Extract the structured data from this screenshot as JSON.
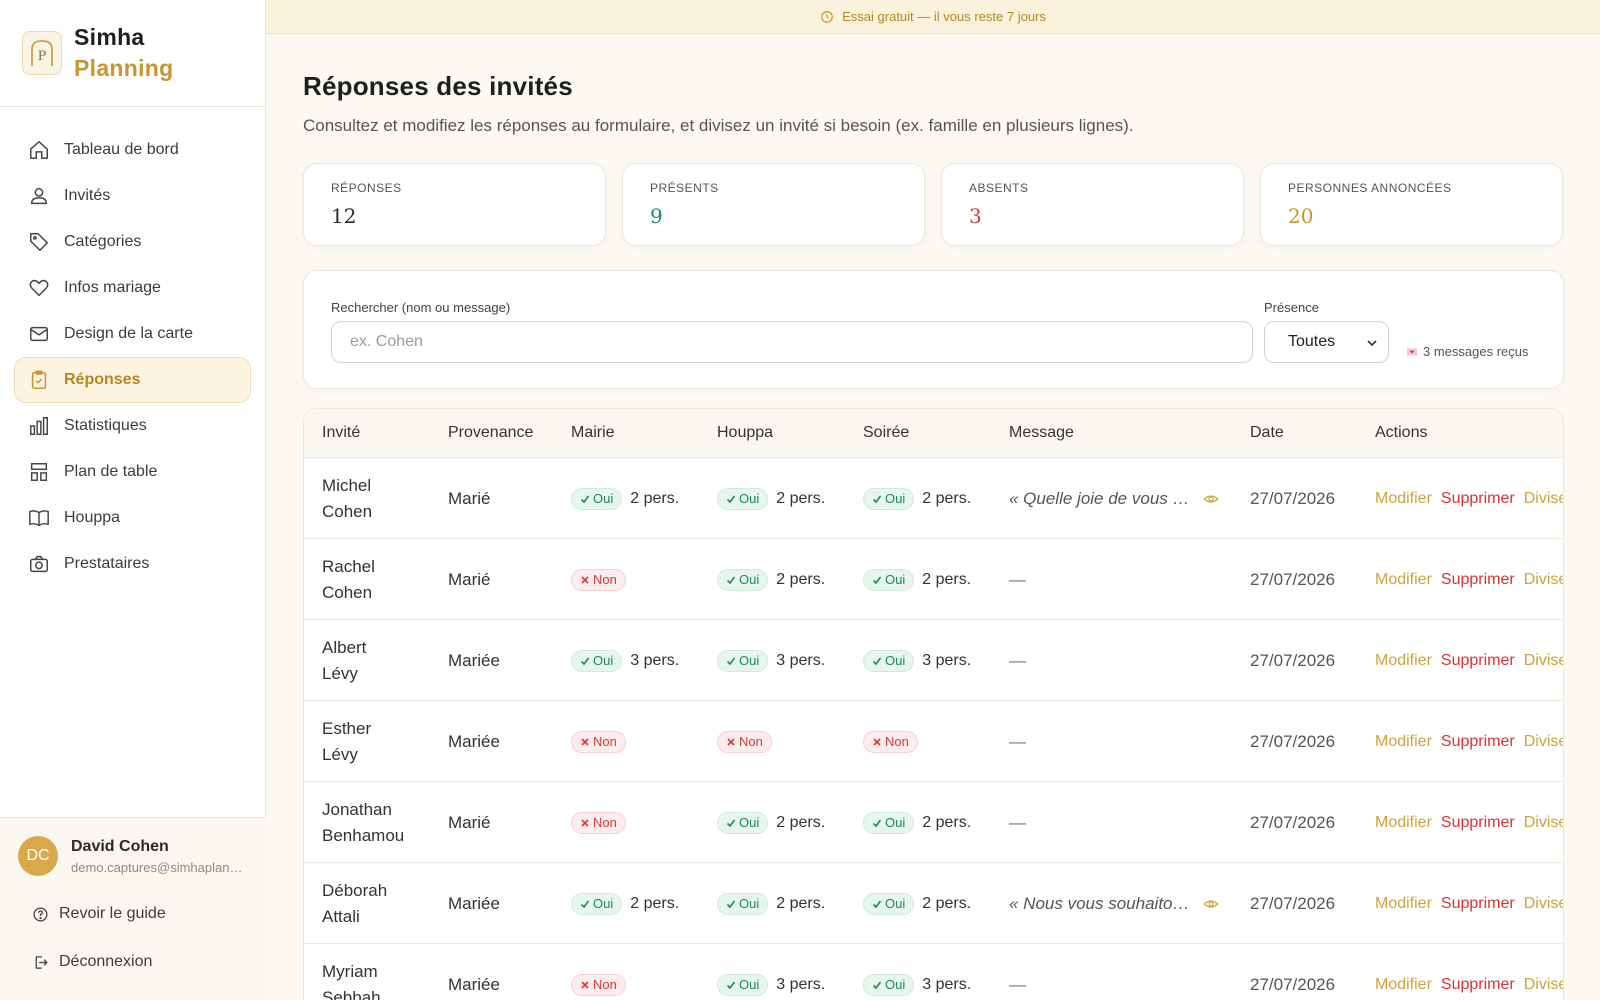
{
  "brand": {
    "line1": "Simha",
    "line2": "Planning"
  },
  "nav": [
    {
      "label": "Tableau de bord",
      "icon": "home-icon"
    },
    {
      "label": "Invités",
      "icon": "users-icon"
    },
    {
      "label": "Catégories",
      "icon": "tag-icon"
    },
    {
      "label": "Infos mariage",
      "icon": "heart-icon"
    },
    {
      "label": "Design de la carte",
      "icon": "mail-icon"
    },
    {
      "label": "Réponses",
      "icon": "clipboard-check-icon",
      "active": true
    },
    {
      "label": "Statistiques",
      "icon": "bar-chart-icon"
    },
    {
      "label": "Plan de table",
      "icon": "layout-icon"
    },
    {
      "label": "Houppa",
      "icon": "book-open-icon"
    },
    {
      "label": "Prestataires",
      "icon": "camera-icon"
    }
  ],
  "user": {
    "initials": "DC",
    "name": "David Cohen",
    "email": "demo.captures@simhaplanning.com"
  },
  "footer": {
    "guide": "Revoir le guide",
    "logout": "Déconnexion"
  },
  "banner": {
    "text": "Essai gratuit — il vous reste 7 jours"
  },
  "page": {
    "title": "Réponses des invités",
    "subtitle": "Consultez et modifiez les réponses au formulaire, et divisez un invité si besoin (ex. famille en plusieurs lignes)."
  },
  "stats": [
    {
      "label": "Réponses",
      "value": "12",
      "color": "#2a2a2a"
    },
    {
      "label": "Présents",
      "value": "9",
      "color": "#1d8a53"
    },
    {
      "label": "Absents",
      "value": "3",
      "color": "#d63a3a"
    },
    {
      "label": "Personnes annoncées",
      "value": "20",
      "color": "#c9952c"
    }
  ],
  "filters": {
    "search_label": "Rechercher (nom ou message)",
    "search_placeholder": "ex. Cohen",
    "presence_label": "Présence",
    "presence_value": "Toutes",
    "messages_count": "3 messages reçus"
  },
  "table": {
    "headers": [
      "Invité",
      "Provenance",
      "Mairie",
      "Houppa",
      "Soirée",
      "Message",
      "Date",
      "Actions"
    ],
    "yes_label": "Oui",
    "no_label": "Non",
    "actions": {
      "edit": "Modifier",
      "delete": "Supprimer",
      "split": "Diviser"
    },
    "rows": [
      {
        "first": "Michel",
        "last": "Cohen",
        "prov": "Marié",
        "mairie": "yes",
        "mairie_pers": "2 pers.",
        "houppa": "yes",
        "houppa_pers": "2 pers.",
        "soiree": "yes",
        "soiree_pers": "2 pers.",
        "message": "« Quelle joie de vous accompagner »",
        "date": "27/07/2026"
      },
      {
        "first": "Rachel",
        "last": "Cohen",
        "prov": "Marié",
        "mairie": "no",
        "mairie_pers": "",
        "houppa": "yes",
        "houppa_pers": "2 pers.",
        "soiree": "yes",
        "soiree_pers": "2 pers.",
        "message": "—",
        "date": "27/07/2026"
      },
      {
        "first": "Albert",
        "last": "Lévy",
        "prov": "Mariée",
        "mairie": "yes",
        "mairie_pers": "3 pers.",
        "houppa": "yes",
        "houppa_pers": "3 pers.",
        "soiree": "yes",
        "soiree_pers": "3 pers.",
        "message": "—",
        "date": "27/07/2026"
      },
      {
        "first": "Esther",
        "last": "Lévy",
        "prov": "Mariée",
        "mairie": "no",
        "mairie_pers": "",
        "houppa": "no",
        "houppa_pers": "",
        "soiree": "no",
        "soiree_pers": "",
        "message": "—",
        "date": "27/07/2026"
      },
      {
        "first": "Jonathan",
        "last": "Benhamou",
        "prov": "Marié",
        "mairie": "no",
        "mairie_pers": "",
        "houppa": "yes",
        "houppa_pers": "2 pers.",
        "soiree": "yes",
        "soiree_pers": "2 pers.",
        "message": "—",
        "date": "27/07/2026"
      },
      {
        "first": "Déborah",
        "last": "Attali",
        "prov": "Mariée",
        "mairie": "yes",
        "mairie_pers": "2 pers.",
        "houppa": "yes",
        "houppa_pers": "2 pers.",
        "soiree": "yes",
        "soiree_pers": "2 pers.",
        "message": "« Nous vous souhaitons tout le bonheur »",
        "date": "27/07/2026"
      },
      {
        "first": "Myriam",
        "last": "Sebbah",
        "prov": "Mariée",
        "mairie": "no",
        "mairie_pers": "",
        "houppa": "yes",
        "houppa_pers": "3 pers.",
        "soiree": "yes",
        "soiree_pers": "3 pers.",
        "message": "—",
        "date": "27/07/2026"
      }
    ]
  }
}
